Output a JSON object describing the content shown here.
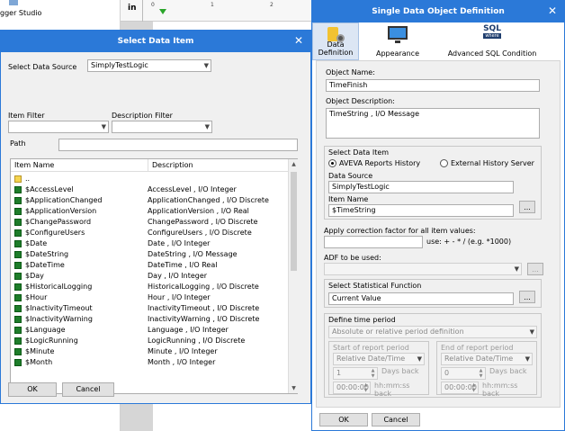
{
  "background": {
    "left_title": "gger Studio",
    "ruler_unit": "in",
    "ruler_ticks": [
      "0",
      "1",
      "2"
    ]
  },
  "select_dialog": {
    "title": "Select Data Item",
    "data_source_label": "Select Data Source",
    "data_source_value": "SimplyTestLogic",
    "item_filter_label": "Item Filter",
    "item_filter_value": "",
    "description_filter_label": "Description Filter",
    "description_filter_value": "",
    "path_label": "Path",
    "path_value": "",
    "columns": [
      "Item Name",
      "Description"
    ],
    "rows": [
      {
        "name": "..",
        "desc": "",
        "icon": "folder-up-icon"
      },
      {
        "name": "$AccessLevel",
        "desc": "AccessLevel , I/O Integer",
        "icon": "tag-icon"
      },
      {
        "name": "$ApplicationChanged",
        "desc": "ApplicationChanged , I/O Discrete",
        "icon": "tag-icon"
      },
      {
        "name": "$ApplicationVersion",
        "desc": "ApplicationVersion , I/O Real",
        "icon": "tag-icon"
      },
      {
        "name": "$ChangePassword",
        "desc": "ChangePassword , I/O Discrete",
        "icon": "tag-icon"
      },
      {
        "name": "$ConfigureUsers",
        "desc": "ConfigureUsers , I/O Discrete",
        "icon": "tag-icon"
      },
      {
        "name": "$Date",
        "desc": "Date , I/O Integer",
        "icon": "tag-icon"
      },
      {
        "name": "$DateString",
        "desc": "DateString , I/O Message",
        "icon": "tag-icon"
      },
      {
        "name": "$DateTime",
        "desc": "DateTime , I/O Real",
        "icon": "tag-icon"
      },
      {
        "name": "$Day",
        "desc": "Day , I/O Integer",
        "icon": "tag-icon"
      },
      {
        "name": "$HistoricalLogging",
        "desc": "HistoricalLogging , I/O Discrete",
        "icon": "tag-icon"
      },
      {
        "name": "$Hour",
        "desc": "Hour , I/O Integer",
        "icon": "tag-icon"
      },
      {
        "name": "$InactivityTimeout",
        "desc": "InactivityTimeout , I/O Discrete",
        "icon": "tag-icon"
      },
      {
        "name": "$InactivityWarning",
        "desc": "InactivityWarning , I/O Discrete",
        "icon": "tag-icon"
      },
      {
        "name": "$Language",
        "desc": "Language , I/O Integer",
        "icon": "tag-icon"
      },
      {
        "name": "$LogicRunning",
        "desc": "LogicRunning , I/O Discrete",
        "icon": "tag-icon"
      },
      {
        "name": "$Minute",
        "desc": "Minute , I/O Integer",
        "icon": "tag-icon"
      },
      {
        "name": "$Month",
        "desc": "Month , I/O Integer",
        "icon": "tag-icon"
      }
    ],
    "ok_label": "OK",
    "cancel_label": "Cancel"
  },
  "definition_dialog": {
    "title": "Single Data Object Definition",
    "tabs": [
      {
        "label": "Data Definition",
        "icon": "data-definition-icon"
      },
      {
        "label": "Appearance",
        "icon": "monitor-icon"
      },
      {
        "label": "Advanced SQL Condition",
        "icon": "sql-where-icon",
        "icon_text": "SQL",
        "icon_subtext": "where"
      }
    ],
    "object_name_label": "Object Name:",
    "object_name_value": "TimeFinish",
    "object_description_label": "Object Description:",
    "object_description_value": "TimeString , I/O Message",
    "select_data_item": {
      "title": "Select Data Item",
      "radio_reports": "AVEVA Reports History",
      "radio_external": "External History Server",
      "selected": "AVEVA Reports History",
      "data_source_label": "Data Source",
      "data_source_value": "SimplyTestLogic",
      "item_name_label": "Item Name",
      "item_name_value": "$TimeString",
      "browse_label": "..."
    },
    "correction_label": "Apply correction factor for all item values:",
    "correction_hint": "use: + - * /  (e.g. *1000)",
    "correction_value": "",
    "adf_label": "ADF to be used:",
    "adf_value": "",
    "adf_browse": "...",
    "statistical": {
      "title": "Select Statistical Function",
      "value": "Current Value",
      "browse_label": "..."
    },
    "time_period": {
      "title": "Define time period",
      "mode_value": "Absolute or relative period definition",
      "start_title": "Start of report period",
      "start_type": "Relative Date/Time",
      "start_days": "1",
      "start_days_label": "Days back",
      "start_time": "00:00:00",
      "start_time_label": "hh:mm:ss back",
      "end_title": "End of report period",
      "end_type": "Relative Date/Time",
      "end_days": "0",
      "end_days_label": "Days back",
      "end_time": "00:00:00",
      "end_time_label": "hh:mm:ss back"
    },
    "ok_label": "OK",
    "cancel_label": "Cancel"
  },
  "colors": {
    "title_bar": "#2b79d8",
    "tag_icon": "#1e7d2a",
    "active_tab": "#dce6f4"
  }
}
